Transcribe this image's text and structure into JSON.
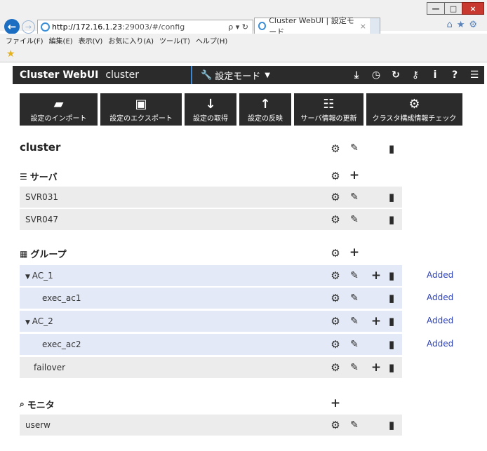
{
  "browser": {
    "url_host": "http://172.16.1.23",
    "url_rest": ":29003/#/config",
    "tab_title": "Cluster WebUI | 設定モード",
    "menu": [
      "ファイル(F)",
      "編集(E)",
      "表示(V)",
      "お気に入り(A)",
      "ツール(T)",
      "ヘルプ(H)"
    ]
  },
  "app": {
    "brand": "Cluster WebUI",
    "cluster_name": "cluster",
    "mode": "設定モード"
  },
  "toolbar": [
    {
      "label": "設定のインポート",
      "icon": "folder-open-icon"
    },
    {
      "label": "設定のエクスポート",
      "icon": "save-icon"
    },
    {
      "label": "設定の取得",
      "icon": "arrow-down-icon"
    },
    {
      "label": "設定の反映",
      "icon": "arrow-up-icon"
    },
    {
      "label": "サーバ情報の更新",
      "icon": "server-refresh-icon"
    },
    {
      "label": "クラスタ構成情報チェック",
      "icon": "gear-check-icon"
    }
  ],
  "main": {
    "title": "cluster",
    "sections": {
      "servers": "サーバ",
      "groups": "グループ",
      "monitors": "モニタ"
    },
    "servers": [
      "SVR031",
      "SVR047"
    ],
    "groups": [
      {
        "name": "AC_1",
        "status": "Added"
      },
      {
        "name": "exec_ac1",
        "status": "Added"
      },
      {
        "name": "AC_2",
        "status": "Added"
      },
      {
        "name": "exec_ac2",
        "status": "Added"
      },
      {
        "name": "failover",
        "status": ""
      }
    ],
    "monitors": [
      "userw"
    ]
  },
  "colors": {
    "appbar": "#2b2b2b",
    "group_row": "#e3e9f7",
    "status": "#2a3fb8"
  }
}
